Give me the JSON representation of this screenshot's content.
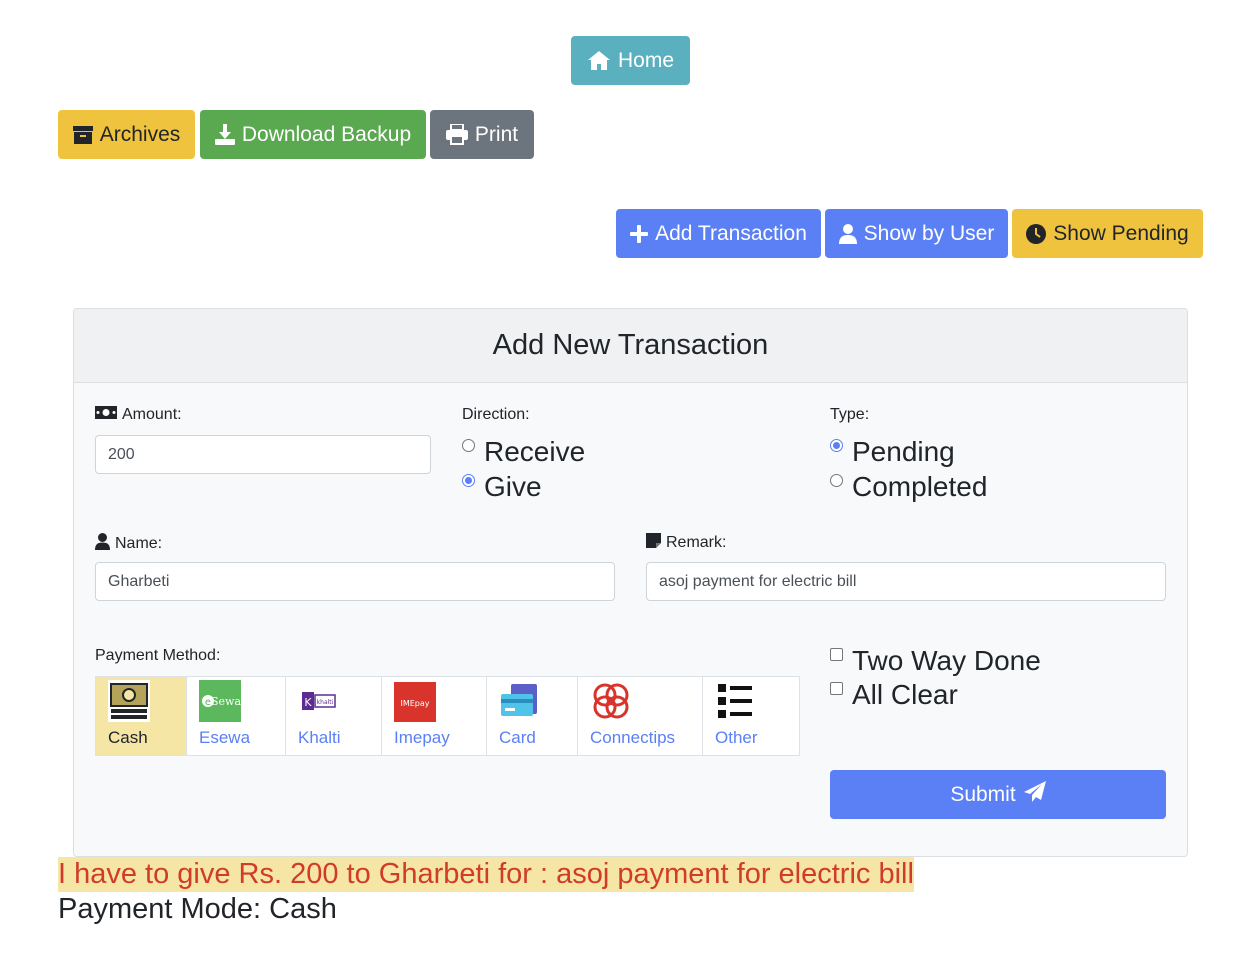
{
  "nav": {
    "home_label": "Home",
    "archives_label": "Archives",
    "download_label": "Download Backup",
    "print_label": "Print",
    "add_transaction_label": "Add Transaction",
    "show_by_user_label": "Show by User",
    "show_pending_label": "Show Pending"
  },
  "form": {
    "title": "Add New Transaction",
    "amount_label": "Amount:",
    "amount_value": "200",
    "direction_label": "Direction:",
    "direction_options": [
      {
        "label": "Receive",
        "checked": false
      },
      {
        "label": "Give",
        "checked": true
      }
    ],
    "type_label": "Type:",
    "type_options": [
      {
        "label": "Pending",
        "checked": true
      },
      {
        "label": "Completed",
        "checked": false
      }
    ],
    "name_label": "Name:",
    "name_value": "Gharbeti",
    "remark_label": "Remark:",
    "remark_value": "asoj payment for electric bill",
    "payment_method_label": "Payment Method:",
    "payment_methods": [
      {
        "label": "Cash",
        "icon": "cash-icon",
        "selected": true
      },
      {
        "label": "Esewa",
        "icon": "esewa-icon",
        "selected": false
      },
      {
        "label": "Khalti",
        "icon": "khalti-icon",
        "selected": false
      },
      {
        "label": "Imepay",
        "icon": "imepay-icon",
        "selected": false
      },
      {
        "label": "Card",
        "icon": "card-icon",
        "selected": false
      },
      {
        "label": "Connectips",
        "icon": "connectips-icon",
        "selected": false
      },
      {
        "label": "Other",
        "icon": "list-icon",
        "selected": false
      }
    ],
    "checkboxes": [
      {
        "label": "Two Way Done",
        "checked": false
      },
      {
        "label": "All Clear",
        "checked": false
      }
    ],
    "submit_label": "Submit"
  },
  "summary": {
    "message": "I have to give Rs. 200 to Gharbeti for : asoj payment for electric bill",
    "payment_mode": "Payment Mode: Cash"
  },
  "colors": {
    "primary": "#5b7ff5",
    "info": "#5bb0c0",
    "warning": "#f0c33e",
    "success": "#5aa84f",
    "secondary": "#6c757d",
    "highlight": "#f6e6a6",
    "summary_text": "#d13b2a"
  }
}
